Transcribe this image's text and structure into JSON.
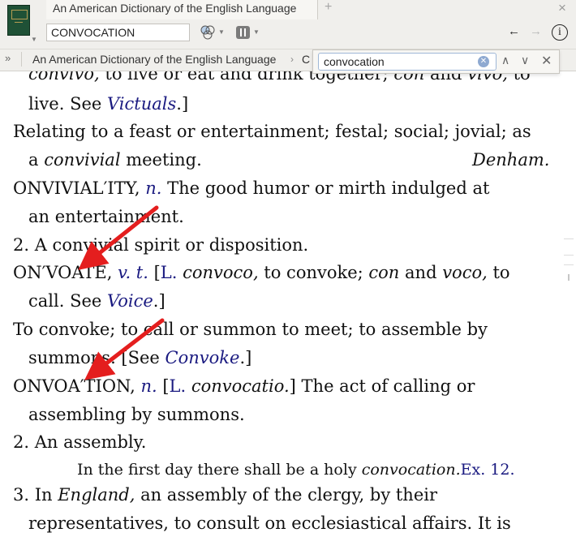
{
  "window": {
    "tab_title": "An American Dictionary of the English Language",
    "tab_add": "+",
    "tab_close": "×"
  },
  "toolbar": {
    "search_value": "CONVOCATION",
    "back": "←",
    "forward": "→",
    "info": "i"
  },
  "breadcrumb": {
    "overflow": "»",
    "item1": "An American Dictionary of the English Language",
    "chevron": "›",
    "item2": "C"
  },
  "find": {
    "value": "convocation",
    "clear": "✕",
    "prev": "∧",
    "next": "∨",
    "close": "✕"
  },
  "content": {
    "l1_a": "convivo,",
    "l1_b": " to live or eat and drink together; ",
    "l1_c": "con",
    "l1_d": " and ",
    "l1_e": "vivo,",
    "l1_f": " to",
    "l2_a": "live. See ",
    "l2_b": "Victuals",
    "l2_c": ".]",
    "l3": "Relating to a feast or entertainment; festal; social; jovial; as",
    "l4_a": "a ",
    "l4_b": "convivial",
    "l4_c": " meeting.",
    "l4_author": "Denham.",
    "l5_a": "ONVIVIAL′ITY, ",
    "l5_b": "n.",
    "l5_c": " The good humor or mirth indulged at",
    "l6": "an entertainment.",
    "l7": "2. A convivial spirit or disposition.",
    "l8_a": "ON′VOATE, ",
    "l8_b": "v. t.",
    "l8_c": " [",
    "l8_d": "L.",
    "l8_e": " ",
    "l8_f": "convoco,",
    "l8_g": " to convoke; ",
    "l8_h": "con",
    "l8_i": " and ",
    "l8_j": "voco,",
    "l8_k": " to",
    "l9_a": "call. See ",
    "l9_b": "Voice",
    "l9_c": ".]",
    "l10": "To convoke; to call or summon to meet; to assemble by",
    "l11_a": "summons. [See ",
    "l11_b": "Convoke",
    "l11_c": ".]",
    "l12_a": "ONVOA′TION, ",
    "l12_b": "n.",
    "l12_c": " [",
    "l12_d": "L.",
    "l12_e": " ",
    "l12_f": "convocatio.",
    "l12_g": "] The act of calling or",
    "l13": "assembling by summons.",
    "l14": "2. An assembly.",
    "l15_a": "In the first day there shall be a holy ",
    "l15_b": "convocation.",
    "l15_c": "Ex. 12.",
    "l16_a": "3. In ",
    "l16_b": "England,",
    "l16_c": " an assembly of the clergy, by their",
    "l17": "representatives, to consult on ecclesiastical affairs. It is"
  },
  "colors": {
    "link_blue": "#1a1a80",
    "arrow_red": "#e41e1e",
    "chrome_bg": "#f0efec"
  },
  "icons": {
    "book": "book-thumbnail-icon",
    "resources": "resources-circles-icon",
    "panels": "panels-icon",
    "info": "info-icon"
  }
}
